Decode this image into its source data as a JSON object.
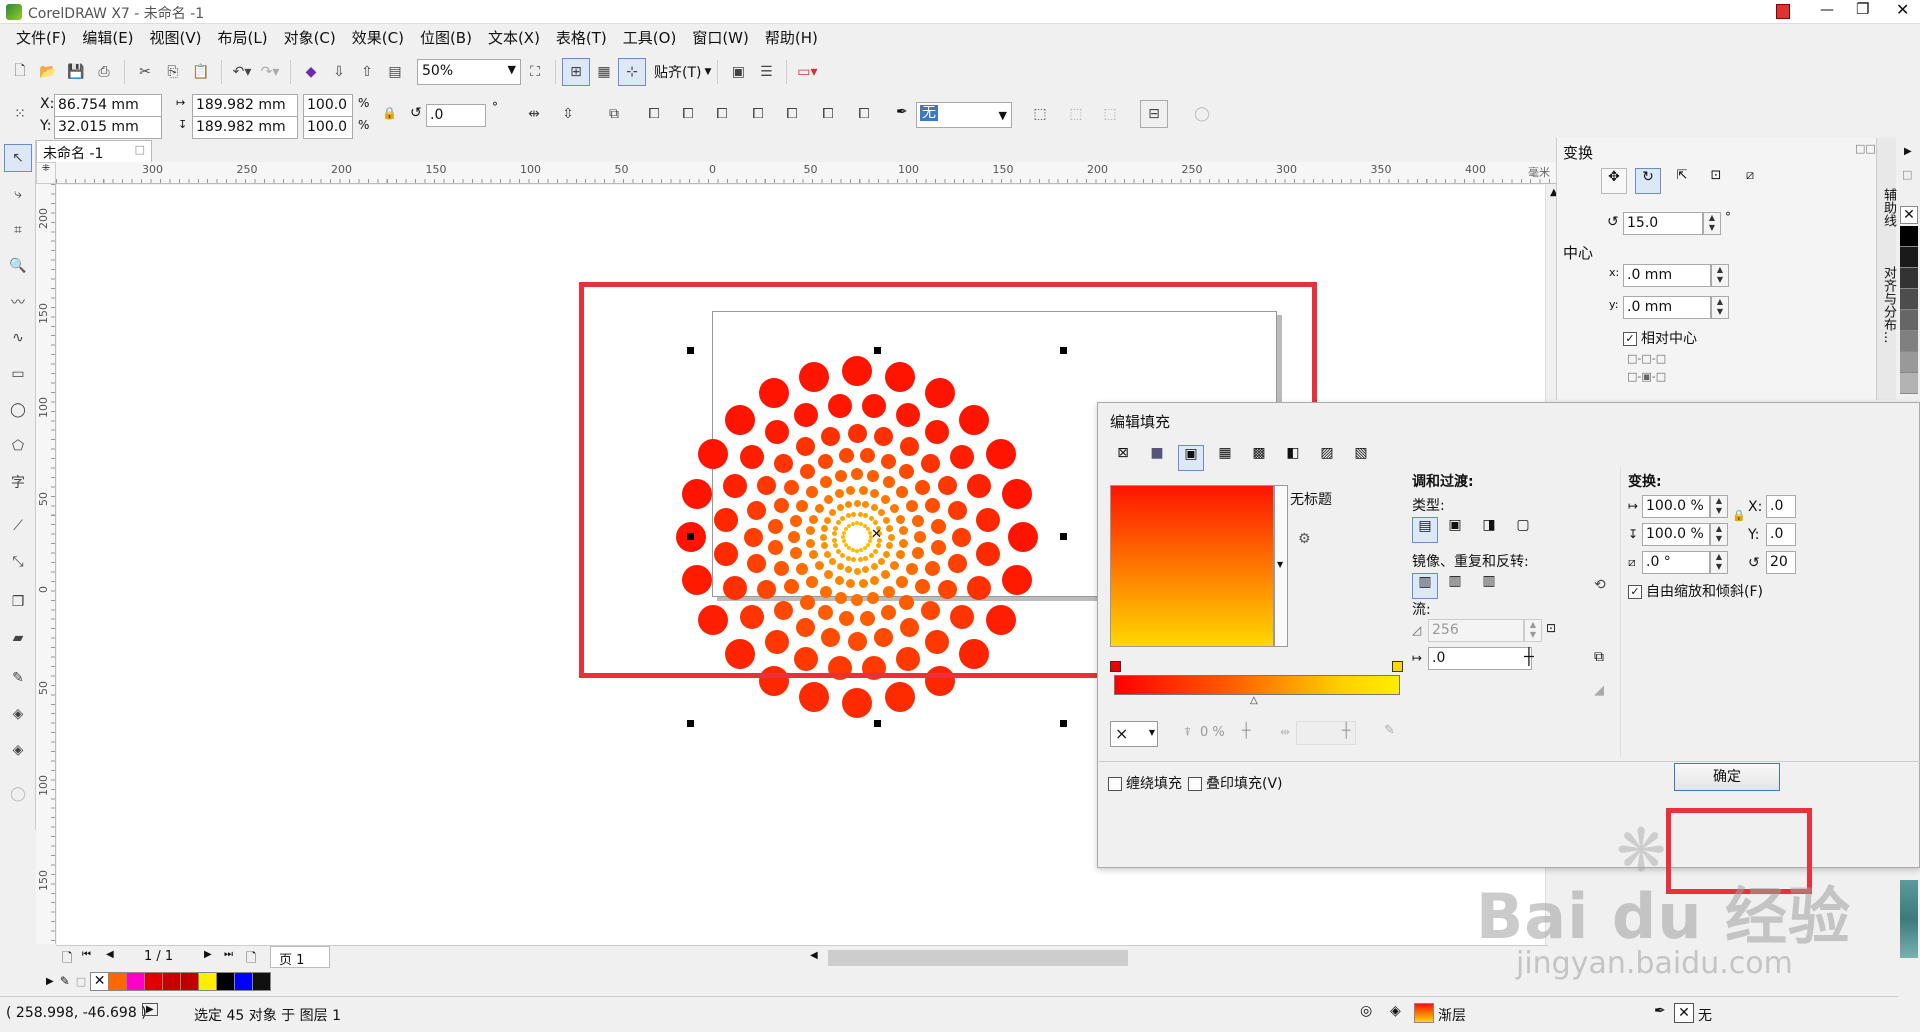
{
  "window": {
    "title": "CorelDRAW X7 - 未命名 -1"
  },
  "menu": [
    "文件(F)",
    "编辑(E)",
    "视图(V)",
    "布局(L)",
    "对象(C)",
    "效果(C)",
    "位图(B)",
    "文本(X)",
    "表格(T)",
    "工具(O)",
    "窗口(W)",
    "帮助(H)"
  ],
  "toolbar": {
    "zoom": "50%",
    "snap_label": "贴齐(T)"
  },
  "property_bar": {
    "x": "86.754 mm",
    "y": "32.015 mm",
    "width": "189.982 mm",
    "height": "189.982 mm",
    "scale_w": "100.0",
    "scale_h": "100.0",
    "percent": "%",
    "angle": ".0",
    "degree": "°",
    "outline": "无"
  },
  "document_tab": "未命名 -1",
  "ruler": {
    "h_ticks": [
      "300",
      "250",
      "200",
      "150",
      "100",
      "50",
      "0",
      "50",
      "100",
      "150",
      "200",
      "250",
      "300",
      "350",
      "400"
    ],
    "unit": "毫米",
    "v_ticks": [
      "200",
      "150",
      "100",
      "50",
      "0",
      "50",
      "100",
      "150"
    ]
  },
  "page_nav": {
    "counter": "1 / 1",
    "page_tab": "页 1"
  },
  "docker": {
    "title": "变换",
    "rotation": "15.0",
    "degree": "°",
    "center_label": "中心",
    "x_label": "x:",
    "x_value": ".0 mm",
    "y_label": "y:",
    "y_value": ".0 mm",
    "relative_center": "相对中心",
    "side_tabs": [
      "辅助线",
      "对齐与分布..."
    ]
  },
  "dialog": {
    "title": "编辑填充",
    "gradient_name": "无标题",
    "blend_section": "调和过渡:",
    "type_label": "类型:",
    "mirror_label": "镜像、重复和反转:",
    "stream_label": "流:",
    "steps": "256",
    "acceleration": ".0",
    "transform_section": "变换:",
    "scale_w": "100.0 %",
    "scale_h": "100.0 %",
    "tilt": ".0 °",
    "x_label": "X:",
    "x_value": ".0",
    "y_label": "Y:",
    "y_value": ".0",
    "rot_value": "20",
    "free_scale": "自由缩放和倾斜(F)",
    "transparency": "0 %",
    "wrap_fill": "缠绕填充",
    "overprint_fill": "叠印填充(V)",
    "ok": "确定"
  },
  "status": {
    "coords": "( 258.998, -46.698 )",
    "selection": "选定 45 对象 于 图层 1",
    "fill_name": "渐层",
    "outline_name": "无"
  },
  "watermark": {
    "brand": "Bai du 经验",
    "url": "jingyan.baidu.com"
  },
  "colors": {
    "annotation": "#e8313a",
    "grad_start": "#ff1400",
    "grad_end": "#ffd800",
    "accent": "#3a78c8"
  },
  "palette": [
    "#ff6600",
    "#ff00cc",
    "#e00000",
    "#c80000",
    "#c00000",
    "#ffee00",
    "#000000",
    "#0000ff",
    "#101010"
  ],
  "side_palette": [
    "#000000",
    "#1a1a1a",
    "#333333",
    "#4d4d4d",
    "#666666",
    "#808080",
    "#999999",
    "#b3b3b3"
  ]
}
